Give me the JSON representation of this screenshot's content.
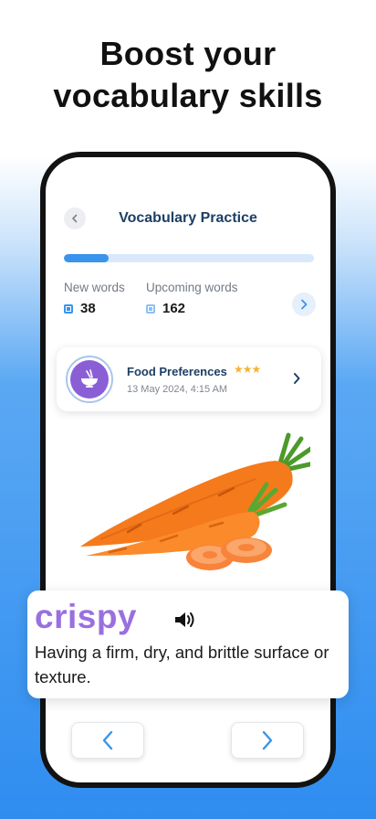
{
  "headline": {
    "line1": "Boost your",
    "line2": "vocabulary skills"
  },
  "screen": {
    "title": "Vocabulary Practice",
    "progress": 0.18
  },
  "stats": {
    "new_words_label": "New words",
    "new_words_value": "38",
    "upcoming_words_label": "Upcoming words",
    "upcoming_words_value": "162"
  },
  "lesson": {
    "title": "Food Preferences",
    "stars": "★★★",
    "date": "13 May 2024, 4:15 AM",
    "icon": "bowl-icon"
  },
  "word_card": {
    "word": "crispy",
    "definition": "Having a firm, dry, and brittle surface or texture."
  },
  "colors": {
    "accent_blue": "#3a93ec",
    "title_navy": "#1d3f66",
    "word_purple": "#9a6fe0",
    "star_gold": "#f2b630",
    "carrot_orange": "#f57a1c"
  }
}
